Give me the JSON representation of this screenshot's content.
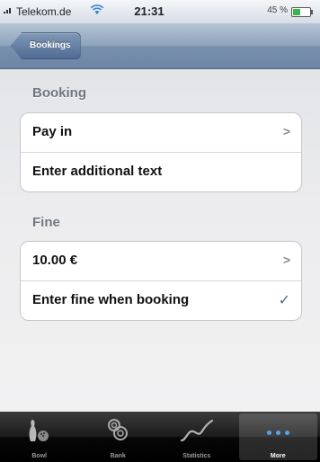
{
  "status_bar": {
    "carrier": "Telekom.de",
    "time": "21:31",
    "battery": "45 %",
    "battery_level": 0.45,
    "wifi_icon": "wifi-icon"
  },
  "nav": {
    "back_label": "Bookings"
  },
  "sections": {
    "booking": {
      "header": "Booking",
      "cells": {
        "pay_in": "Pay in",
        "additional_text": "Enter additional text"
      }
    },
    "fine": {
      "header": "Fine",
      "cells": {
        "amount": "10.00 €",
        "enter_fine": "Enter fine when booking"
      }
    }
  },
  "glyphs": {
    "chevron": ">",
    "check": "✓"
  },
  "tabs": [
    {
      "label": "Bowl",
      "icon": "bowling-pins-icon"
    },
    {
      "label": "Bank",
      "icon": "piggy-bank-icon"
    },
    {
      "label": "Statistics",
      "icon": "statistics-line-icon"
    },
    {
      "label": "More",
      "icon": "more-dots-icon",
      "active": true
    }
  ],
  "colors": {
    "accent_check": "#4d6c99",
    "nav_bar": "#7990ad",
    "more_dots": "#57a2f0"
  }
}
